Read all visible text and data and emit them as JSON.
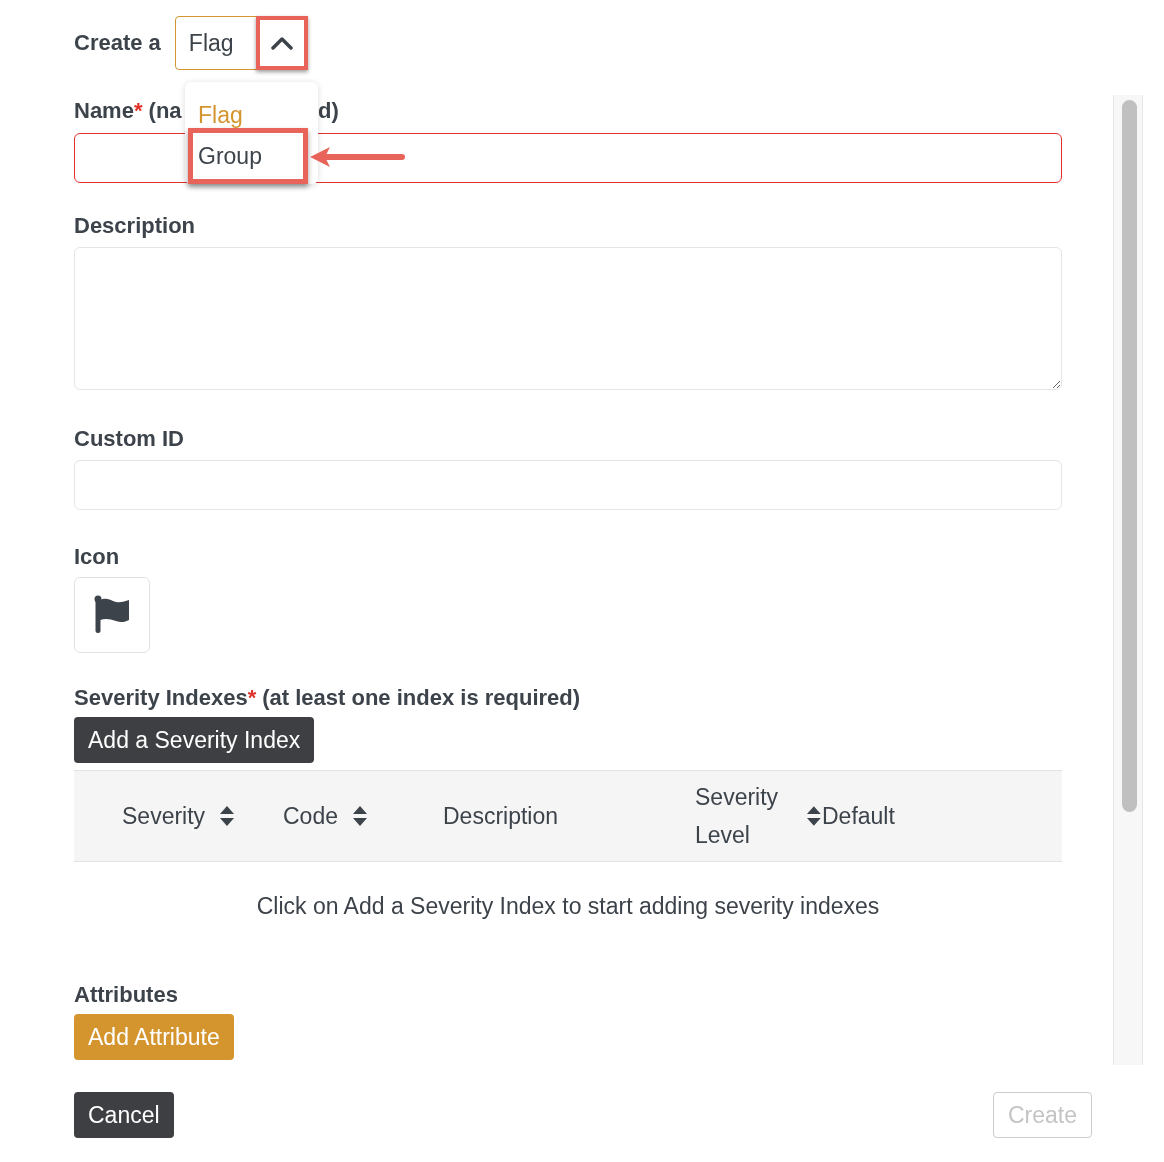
{
  "header": {
    "label": "Create a",
    "select": {
      "value": "Flag",
      "expanded": true
    }
  },
  "dropdown": {
    "options": [
      {
        "label": "Flag",
        "selected": true,
        "highlighted": false
      },
      {
        "label": "Group",
        "selected": false,
        "highlighted": true
      }
    ]
  },
  "name": {
    "label": "Name",
    "required_mark": "*",
    "label_visible_start": "(na",
    "label_visible_end": "d)",
    "invalid": true
  },
  "description": {
    "label": "Description"
  },
  "custom_id": {
    "label": "Custom ID"
  },
  "icon": {
    "label": "Icon"
  },
  "severity": {
    "label": "Severity Indexes",
    "required_mark": "*",
    "note": "(at least one index is required)",
    "add_button": "Add a Severity Index",
    "columns": [
      {
        "label": "Severity",
        "sortable": true
      },
      {
        "label": "Code",
        "sortable": true
      },
      {
        "label": "Description",
        "sortable": false
      },
      {
        "label": "Severity Level",
        "sortable": true
      },
      {
        "label": "Default",
        "sortable": false
      }
    ],
    "empty_text": "Click on Add a Severity Index to start adding severity indexes"
  },
  "attributes": {
    "label": "Attributes",
    "add_button": "Add Attribute"
  },
  "footer": {
    "cancel": "Cancel",
    "create": {
      "label": "Create",
      "disabled": true
    }
  }
}
